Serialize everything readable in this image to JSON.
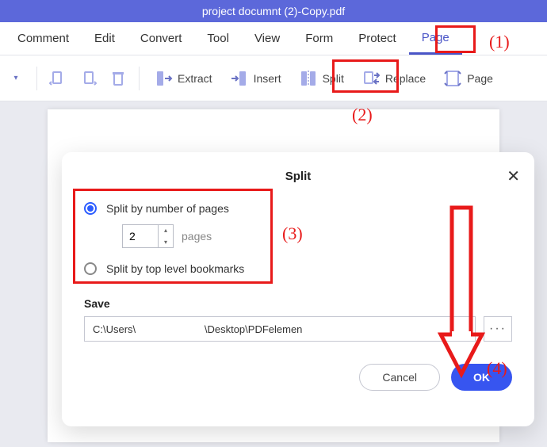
{
  "title": "project documnt (2)-Copy.pdf",
  "menu": {
    "items": [
      "Comment",
      "Edit",
      "Convert",
      "Tool",
      "View",
      "Form",
      "Protect",
      "Page"
    ],
    "active": 7
  },
  "toolbar": {
    "extract": "Extract",
    "insert": "Insert",
    "split": "Split",
    "replace": "Replace",
    "page": "Page"
  },
  "dialog": {
    "title": "Split",
    "opt_pages": "Split by number of pages",
    "pages_value": "2",
    "pages_unit": "pages",
    "opt_bookmarks": "Split by top level bookmarks",
    "save_label": "Save",
    "path_value": "C:\\Users\\                        \\Desktop\\PDFelemen",
    "browse": "···",
    "cancel": "Cancel",
    "ok": "OK"
  },
  "annotations": {
    "n1": "(1)",
    "n2": "(2)",
    "n3": "(3)",
    "n4": "(4)"
  },
  "colors": {
    "accent": "#5c68da",
    "primary_btn": "#3755f0",
    "anno": "#e81a1a"
  }
}
